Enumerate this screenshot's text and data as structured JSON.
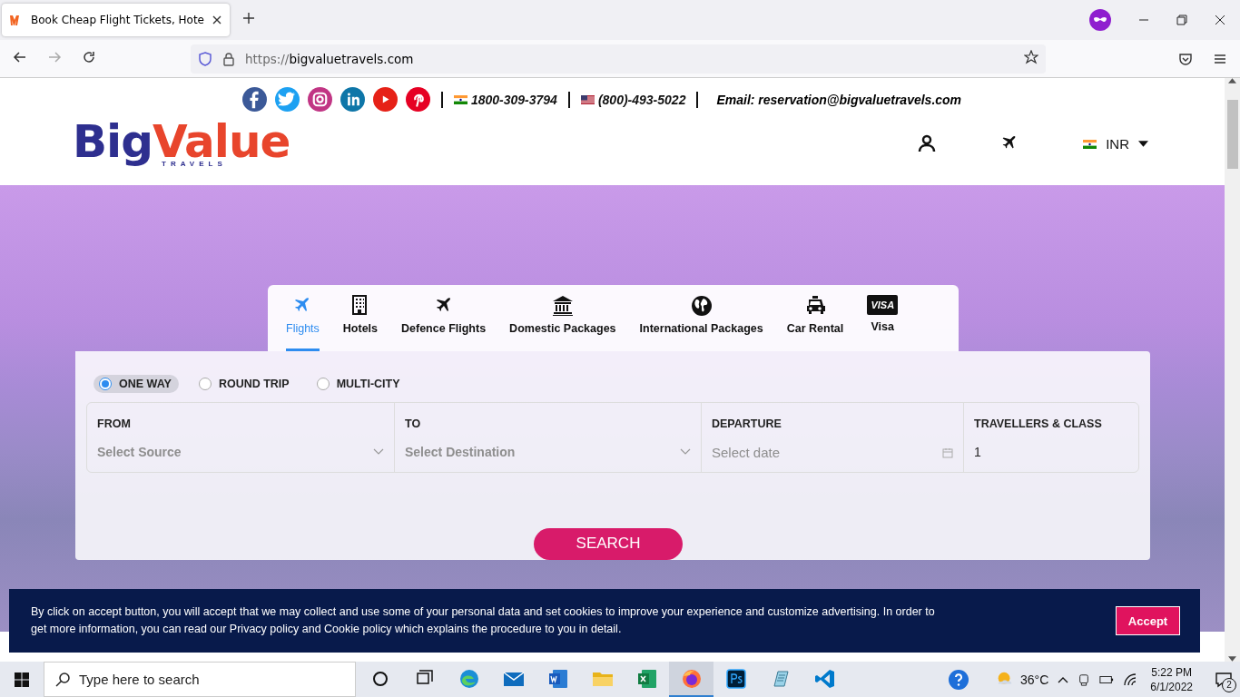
{
  "browser": {
    "tab_title": "Book Cheap Flight Tickets, Hote",
    "url_scheme": "https://",
    "url_host": "bigvaluetravels.com"
  },
  "header": {
    "social": [
      {
        "color": "#3b5998"
      },
      {
        "color": "#1da1f2"
      },
      {
        "color": "#c13584"
      },
      {
        "color": "#0e76a8"
      },
      {
        "color": "#e62117"
      },
      {
        "color": "#e60023"
      }
    ],
    "phones": [
      {
        "kind": "india",
        "number": "1800-309-3794"
      },
      {
        "kind": "usa",
        "number": "(800)-493-5022"
      }
    ],
    "email": "Email: reservation@bigvaluetravels.com",
    "logo": {
      "word_1": "Big",
      "word_2": "Value",
      "tagline": "TRAVELS"
    },
    "currency": "INR"
  },
  "service_tabs": [
    {
      "kind": "plane",
      "label": "Flights",
      "selected": true
    },
    {
      "kind": "building",
      "label": "Hotels",
      "selected": false
    },
    {
      "kind": "plane",
      "label": "Defence Flights",
      "selected": false
    },
    {
      "kind": "bank",
      "label": "Domestic Packages",
      "selected": false
    },
    {
      "kind": "globe",
      "label": "International Packages",
      "selected": false
    },
    {
      "kind": "taxi",
      "label": "Car Rental",
      "selected": false
    },
    {
      "kind": "card",
      "label": "Visa",
      "badge": "VISA",
      "selected": false
    }
  ],
  "trip_types": [
    {
      "label": "ONE WAY",
      "selected": true
    },
    {
      "label": "ROUND TRIP",
      "selected": false
    },
    {
      "label": "MULTI-CITY",
      "selected": false
    }
  ],
  "fields": [
    {
      "kind": "select",
      "label": "FROM",
      "placeholder": "Select Source"
    },
    {
      "kind": "select",
      "label": "TO",
      "placeholder": "Select Destination"
    },
    {
      "kind": "date",
      "label": "DEPARTURE",
      "placeholder": "Select date"
    },
    {
      "kind": "text",
      "label": "TRAVELLERS & CLASS",
      "value": "1"
    }
  ],
  "search_button": "SEARCH",
  "cookie_notice": {
    "text": "By click on accept button, you will accept that we may collect and use some of your personal data and set cookies to improve your experience and customize advertising. In order to get more information, you can read our Privacy policy and Cookie policy which explains the procedure to you in detail.",
    "button": "Accept"
  },
  "taskbar": {
    "search_placeholder": "Type here to search",
    "apps": [
      {
        "kind": "circle",
        "selected": false
      },
      {
        "kind": "taskview",
        "selected": false
      },
      {
        "kind": "edge",
        "selected": false
      },
      {
        "kind": "mail",
        "selected": false
      },
      {
        "kind": "word",
        "selected": false
      },
      {
        "kind": "folder",
        "selected": false
      },
      {
        "kind": "excel",
        "selected": false
      },
      {
        "kind": "firefox",
        "selected": true
      },
      {
        "kind": "photoshop",
        "selected": false
      },
      {
        "kind": "notes",
        "selected": false
      },
      {
        "kind": "vscode",
        "selected": false
      }
    ],
    "temperature": "36°C",
    "time": "5:22 PM",
    "date": "6/1/2022",
    "notifications": "2"
  }
}
